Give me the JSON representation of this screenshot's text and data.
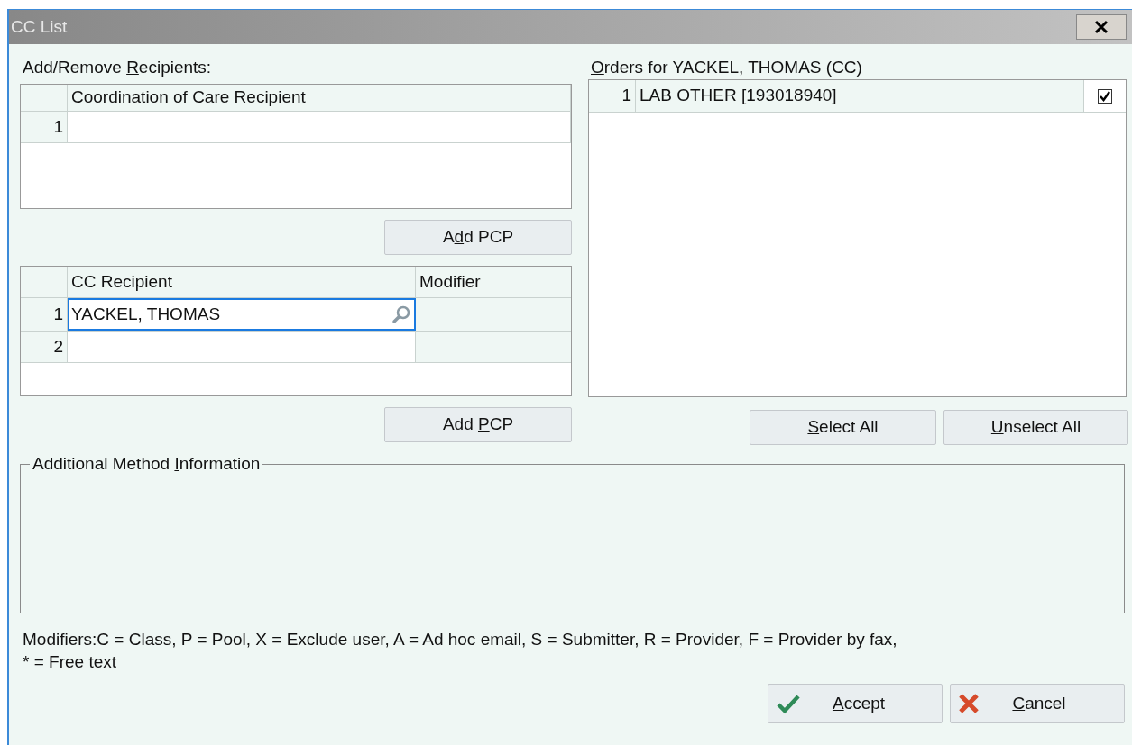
{
  "window": {
    "title": "CC List"
  },
  "recipients": {
    "label": [
      {
        "text": "Add/Remove ",
        "underline": false
      },
      {
        "text": "R",
        "underline": true
      },
      {
        "text": "ecipients:",
        "underline": false
      }
    ],
    "coordination_grid": {
      "columns": [
        "Coordination of Care Recipient"
      ],
      "rows": [
        {
          "number": "1"
        }
      ]
    },
    "add_pcp_button": [
      {
        "text": "A",
        "underline": false
      },
      {
        "text": "d",
        "underline": true
      },
      {
        "text": "d PCP",
        "underline": false
      }
    ],
    "cc_grid": {
      "columns": [
        "CC Recipient",
        "Modifier"
      ],
      "rows": [
        {
          "number": "1",
          "recipient": "YACKEL, THOMAS",
          "focused": true
        },
        {
          "number": "2",
          "focused": false
        }
      ]
    },
    "add_pcp_button_2": [
      {
        "text": "Add ",
        "underline": false
      },
      {
        "text": "P",
        "underline": true
      },
      {
        "text": "CP",
        "underline": false
      }
    ]
  },
  "orders": {
    "label": [
      {
        "text": "O",
        "underline": true
      },
      {
        "text": "rders for YACKEL, THOMAS (CC)",
        "underline": false
      }
    ],
    "rows": [
      {
        "number": "1",
        "name": "LAB OTHER [193018940]",
        "checked": true
      }
    ],
    "buttons": [
      [
        {
          "text": "S",
          "underline": true
        },
        {
          "text": "elect All",
          "underline": false
        }
      ],
      [
        {
          "text": "U",
          "underline": true
        },
        {
          "text": "nselect All",
          "underline": false
        }
      ]
    ]
  },
  "method_info": {
    "legend": [
      {
        "text": "Additional Method ",
        "underline": false
      },
      {
        "text": "I",
        "underline": true
      },
      {
        "text": "nformation",
        "underline": false
      }
    ]
  },
  "modifiers_note": [
    "Modifiers:C = Class, P = Pool, X = Exclude user, A = Ad hoc email, S = Submitter, R = Provider, F = Provider by fax,",
    "* = Free text"
  ],
  "footer_buttons": [
    {
      "kind": "accept",
      "label": [
        {
          "text": "A",
          "underline": true
        },
        {
          "text": "ccept",
          "underline": false
        }
      ]
    },
    {
      "kind": "cancel",
      "label": [
        {
          "text": "C",
          "underline": true
        },
        {
          "text": "ancel",
          "underline": false
        }
      ]
    }
  ]
}
